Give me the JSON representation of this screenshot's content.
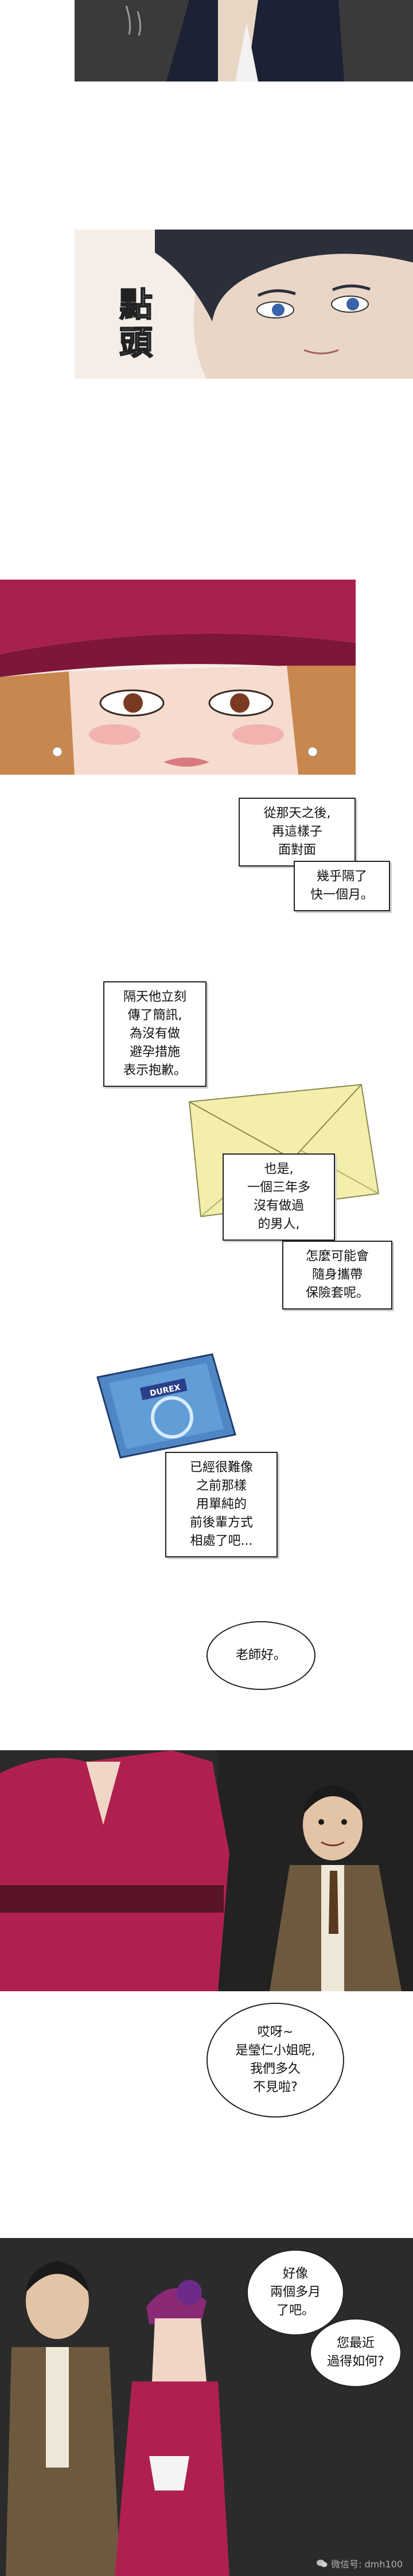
{
  "panel1": {
    "panel_desc": ""
  },
  "panel2": {
    "sfx": "點頭"
  },
  "panel3": {},
  "captions": {
    "c1": "從那天之後,\n再這樣子\n面對面",
    "c2": "幾乎隔了\n快一個月。",
    "c3": "隔天他立刻\n傳了簡訊,\n為沒有做\n避孕措施\n表示抱歉。",
    "c4": "也是,\n一個三年多\n沒有做過\n的男人,",
    "c5": "怎麼可能會\n隨身攜帶\n保險套呢。",
    "c6": "已經很難像\n之前那樣\n用單純的\n前後輩方式\n相處了吧..."
  },
  "bubbles": {
    "b1": "老師好。",
    "b2": "哎呀~\n是瑩仁小姐呢,\n我們多久\n不見啦?",
    "b3": "好像\n兩個多月\n了吧。",
    "b4": "您最近\n過得如何?"
  },
  "props": {
    "condom_brand": "DUREX"
  },
  "watermark": {
    "text": "微信号: dmh100"
  },
  "colors": {
    "hat": "#a8204f",
    "dress": "#b0204f",
    "envelope": "#f3efaa",
    "packet": "#4f86c6",
    "bar_bg": "#2a2a2a"
  }
}
